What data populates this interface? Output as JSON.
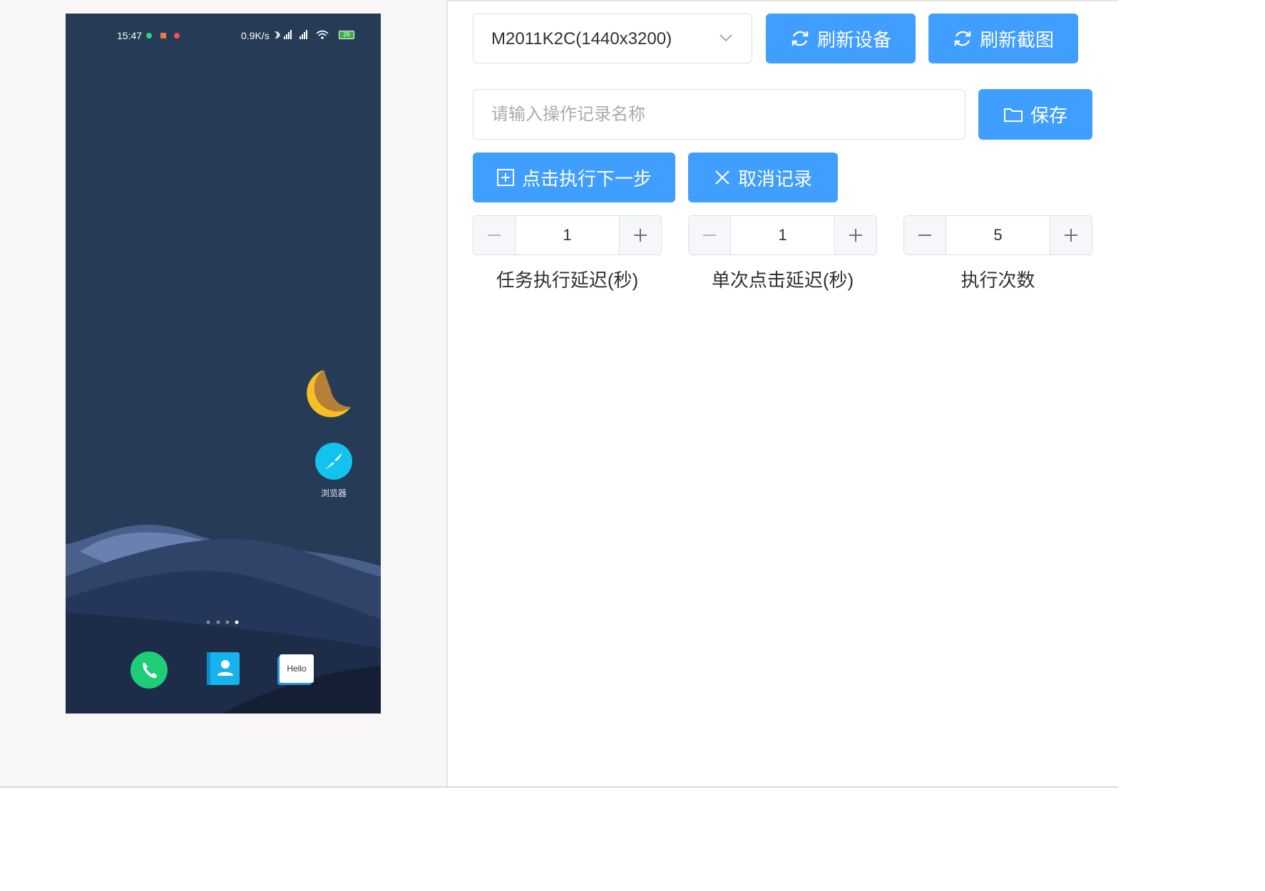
{
  "phone": {
    "status_time": "15:47",
    "status_speed": "0.9K/s",
    "battery": "26",
    "browser_label": "浏览器",
    "hello_label": "Hello"
  },
  "toolbar": {
    "device_select_value": "M2011K2C(1440x3200)",
    "refresh_device_label": "刷新设备",
    "refresh_screenshot_label": "刷新截图"
  },
  "record": {
    "name_placeholder": "请输入操作记录名称",
    "save_label": "保存",
    "next_step_label": "点击执行下一步",
    "cancel_label": "取消记录"
  },
  "steppers": [
    {
      "value": "1",
      "label": "任务执行延迟(秒)"
    },
    {
      "value": "1",
      "label": "单次点击延迟(秒)"
    },
    {
      "value": "5",
      "label": "执行次数"
    }
  ],
  "colors": {
    "primary": "#409eff",
    "border": "#dcdfe6",
    "phone_bg": "#253b56"
  }
}
